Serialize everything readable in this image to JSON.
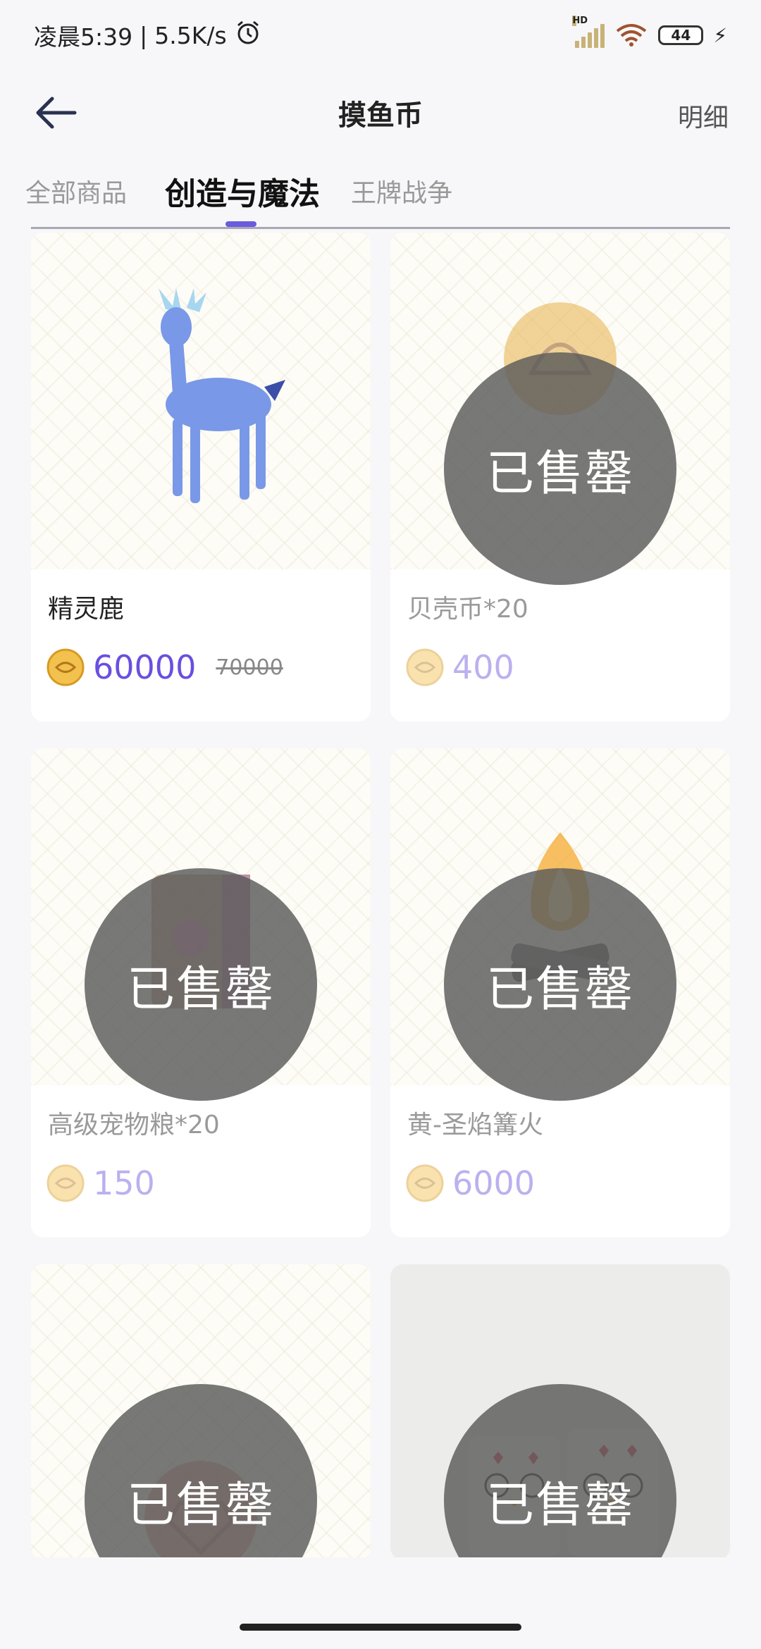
{
  "status_bar": {
    "time": "凌晨5:39",
    "net_speed": "5.5K/s",
    "battery": "44",
    "icons": [
      "alarm-icon",
      "hd-signal-icon",
      "wifi-icon",
      "battery-icon",
      "charging-icon"
    ]
  },
  "header": {
    "title": "摸鱼币",
    "detail_label": "明细",
    "back_icon": "arrow-left-icon"
  },
  "tabs": [
    {
      "label": "全部商品",
      "active": false
    },
    {
      "label": "创造与魔法",
      "active": true
    },
    {
      "label": "王牌战争",
      "active": false
    }
  ],
  "colors": {
    "accent": "#6a5be0",
    "price": "#6a4fe0",
    "soldout_overlay": "#5a5a5a"
  },
  "products": [
    {
      "name": "精灵鹿",
      "price": "60000",
      "original_price": "70000",
      "sold_out": false,
      "image": "spirit-deer-image"
    },
    {
      "name": "贝壳币*20",
      "price": "400",
      "sold_out": true,
      "soldout_label": "已售罄",
      "image": "shell-coin-image"
    },
    {
      "name": "高级宠物粮*20",
      "price": "150",
      "sold_out": true,
      "soldout_label": "已售罄",
      "image": "pet-food-bag-image"
    },
    {
      "name": "黄-圣焰篝火",
      "price": "6000",
      "sold_out": true,
      "soldout_label": "已售罄",
      "image": "bonfire-image"
    },
    {
      "name": "",
      "price": "",
      "sold_out": true,
      "soldout_label": "已售罄",
      "image": "red-gem-coin-image"
    },
    {
      "name": "",
      "price": "",
      "sold_out": true,
      "soldout_label": "已售罄",
      "image": "penguin-plush-image"
    }
  ]
}
